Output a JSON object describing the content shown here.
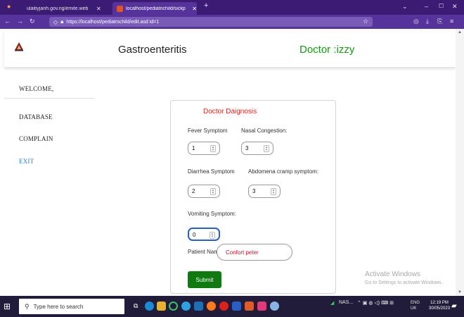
{
  "browser": {
    "tabs": [
      {
        "title": "ulaitiyjanh.gov.ng/emite.web",
        "active": false
      },
      {
        "title": "localhost/pediatrichild/sickp",
        "active": true
      }
    ],
    "url": "https://localhost/pediatrschild/edit.asd id=1",
    "new_tab": "+",
    "window_controls": [
      "⌄",
      "–",
      "☐",
      "✕"
    ]
  },
  "header": {
    "title": "Gastroenteritis",
    "doctor": "Doctor :izzy"
  },
  "sidebar": {
    "welcome": "WELCOME,",
    "items": [
      {
        "label": "DATABASE"
      },
      {
        "label": "COMPLAIN"
      },
      {
        "label": "EXIT"
      }
    ]
  },
  "form": {
    "title": "Doctor Daignosis",
    "fields": [
      {
        "label": "Fever Symptom",
        "value": "1"
      },
      {
        "label": "Nasal Congestion:",
        "value": "3"
      },
      {
        "label": "Diarrhea Symptom",
        "value": "2"
      },
      {
        "label": "Abdomena cramp symptom:",
        "value": "3"
      },
      {
        "label": "Vomiting Symptom:",
        "value": "0"
      }
    ],
    "patient_label": "Patient Name:",
    "patient_value": "Confort peter",
    "submit_label": "Submit"
  },
  "watermark": {
    "line1": "Activate Windows",
    "line2": "Go to Settings to activate Windows."
  },
  "taskbar": {
    "search_placeholder": "Type here to search",
    "tray_text": "NAS...",
    "lang": "ENG",
    "region": "UK",
    "time": "12:19 PM",
    "date": "30/05/2023"
  },
  "colors": {
    "browser_chrome": "#55339a",
    "title_red": "#e0201a",
    "doctor_green": "#159a15",
    "submit_green": "#0f7a0f",
    "exit_blue": "#2a7fd4"
  }
}
